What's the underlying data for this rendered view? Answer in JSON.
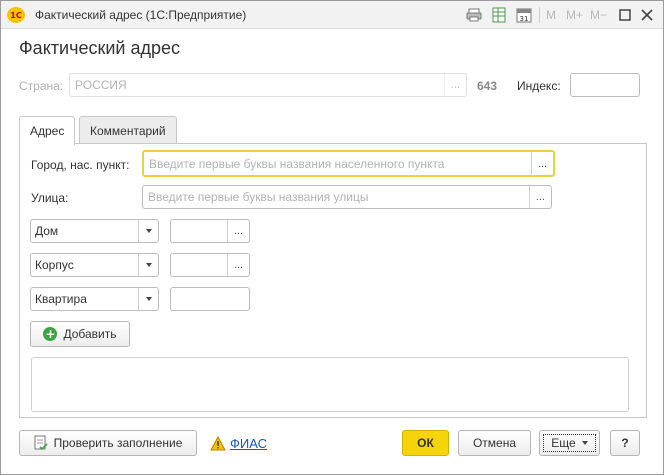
{
  "window": {
    "app_logo": "1С",
    "title": "Фактический адрес  (1С:Предприятие)",
    "toolbar": {
      "m_label": "M",
      "m_plus_label": "M+",
      "m_minus_label": "M−"
    }
  },
  "page_title": "Фактический адрес",
  "country": {
    "label": "Страна:",
    "value": "РОССИЯ",
    "code": "643",
    "index_label": "Индекс:",
    "index_value": ""
  },
  "tabs": [
    {
      "label": "Адрес",
      "active": true
    },
    {
      "label": "Комментарий",
      "active": false
    }
  ],
  "address": {
    "city_label": "Город, нас. пункт:",
    "city_placeholder": "Введите первые буквы названия населенного пункта",
    "street_label": "Улица:",
    "street_placeholder": "Введите первые буквы названия улицы",
    "rows": [
      {
        "type": "Дом",
        "value": "",
        "has_picker": true
      },
      {
        "type": "Корпус",
        "value": "",
        "has_picker": true
      },
      {
        "type": "Квартира",
        "value": "",
        "has_picker": false
      }
    ],
    "add_button": "Добавить",
    "choice_button": "..."
  },
  "footer": {
    "check_button": "Проверить заполнение",
    "fias_link": "ФИАС",
    "ok_button": "ОК",
    "cancel_button": "Отмена",
    "more_button": "Еще",
    "help_button": "?"
  },
  "colors": {
    "primary_button": "#f5d40b",
    "focus_border": "#f0cf3a",
    "link": "#1a57b8",
    "add_icon": "#3aa641"
  }
}
